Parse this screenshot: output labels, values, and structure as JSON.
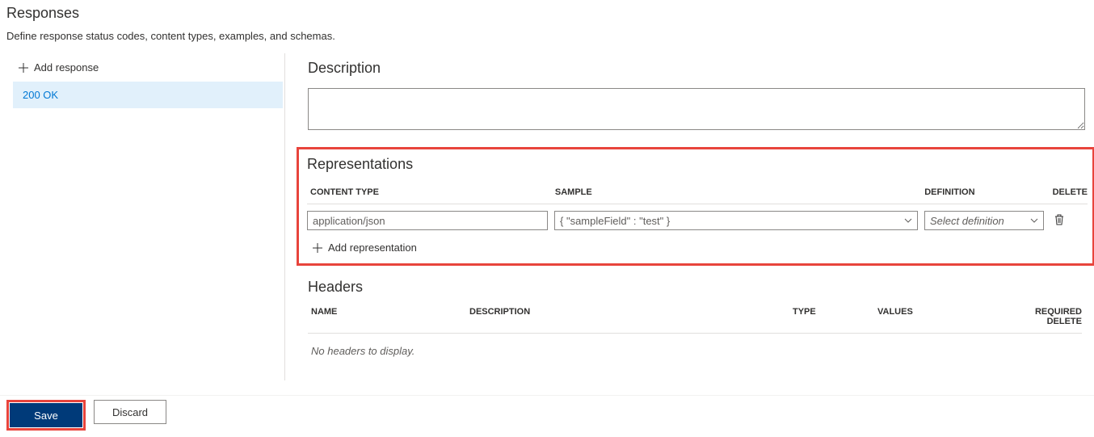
{
  "page": {
    "title": "Responses",
    "subtitle": "Define response status codes, content types, examples, and schemas."
  },
  "sidebar": {
    "add_response_label": "Add response",
    "items": [
      {
        "label": "200 OK"
      }
    ]
  },
  "detail": {
    "description_heading": "Description",
    "description_value": "",
    "representations": {
      "heading": "Representations",
      "columns": {
        "content_type": "CONTENT TYPE",
        "sample": "SAMPLE",
        "definition": "DEFINITION",
        "delete": "DELETE"
      },
      "rows": [
        {
          "content_type": "application/json",
          "sample": "{ \"sampleField\" : \"test\" }",
          "definition_placeholder": "Select definition"
        }
      ],
      "add_label": "Add representation"
    },
    "headers": {
      "heading": "Headers",
      "columns": {
        "name": "NAME",
        "description": "DESCRIPTION",
        "type": "TYPE",
        "values": "VALUES",
        "required_delete": "REQUIRED DELETE"
      },
      "empty_message": "No headers to display."
    }
  },
  "buttons": {
    "save": "Save",
    "discard": "Discard"
  }
}
